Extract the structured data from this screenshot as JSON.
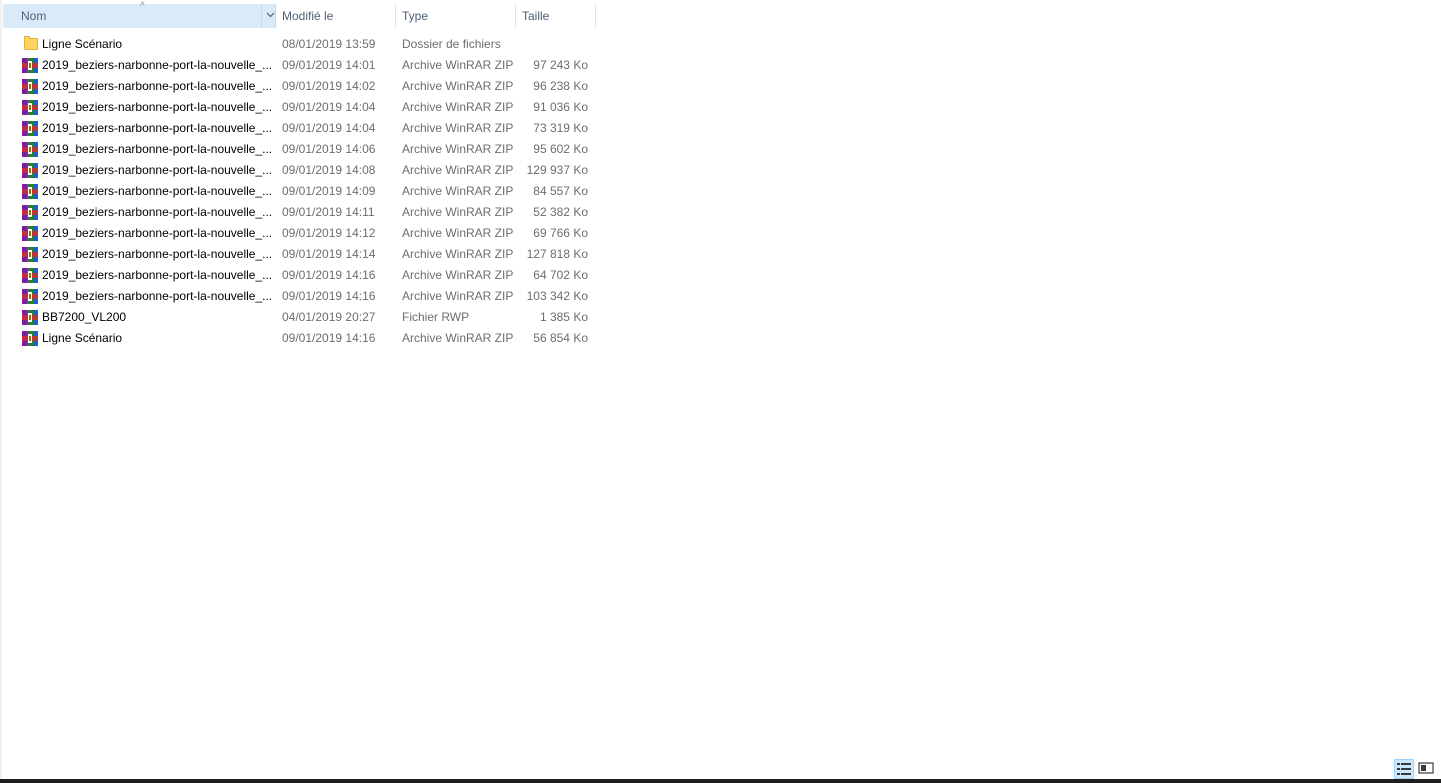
{
  "columns": {
    "name": "Nom",
    "modified": "Modifié le",
    "type": "Type",
    "size": "Taille"
  },
  "icons": {
    "sort": "sort-ascending-icon",
    "dropdown": "chevron-down-icon",
    "folder": "folder-icon",
    "archive": "winrar-archive-icon",
    "details_view": "details-view-icon",
    "tiles_view": "large-icons-view-icon"
  },
  "files": [
    {
      "name": "Ligne Scénario",
      "date": "08/01/2019 13:59",
      "type": "Dossier de fichiers",
      "size": "",
      "icon": "folder"
    },
    {
      "name": "2019_beziers-narbonne-port-la-nouvelle_...",
      "date": "09/01/2019 14:01",
      "type": "Archive WinRAR ZIP",
      "size": "97 243 Ko",
      "icon": "archive"
    },
    {
      "name": "2019_beziers-narbonne-port-la-nouvelle_...",
      "date": "09/01/2019 14:02",
      "type": "Archive WinRAR ZIP",
      "size": "96 238 Ko",
      "icon": "archive"
    },
    {
      "name": "2019_beziers-narbonne-port-la-nouvelle_...",
      "date": "09/01/2019 14:04",
      "type": "Archive WinRAR ZIP",
      "size": "91 036 Ko",
      "icon": "archive"
    },
    {
      "name": "2019_beziers-narbonne-port-la-nouvelle_...",
      "date": "09/01/2019 14:04",
      "type": "Archive WinRAR ZIP",
      "size": "73 319 Ko",
      "icon": "archive"
    },
    {
      "name": "2019_beziers-narbonne-port-la-nouvelle_...",
      "date": "09/01/2019 14:06",
      "type": "Archive WinRAR ZIP",
      "size": "95 602 Ko",
      "icon": "archive"
    },
    {
      "name": "2019_beziers-narbonne-port-la-nouvelle_...",
      "date": "09/01/2019 14:08",
      "type": "Archive WinRAR ZIP",
      "size": "129 937 Ko",
      "icon": "archive"
    },
    {
      "name": "2019_beziers-narbonne-port-la-nouvelle_...",
      "date": "09/01/2019 14:09",
      "type": "Archive WinRAR ZIP",
      "size": "84 557 Ko",
      "icon": "archive"
    },
    {
      "name": "2019_beziers-narbonne-port-la-nouvelle_...",
      "date": "09/01/2019 14:11",
      "type": "Archive WinRAR ZIP",
      "size": "52 382 Ko",
      "icon": "archive"
    },
    {
      "name": "2019_beziers-narbonne-port-la-nouvelle_...",
      "date": "09/01/2019 14:12",
      "type": "Archive WinRAR ZIP",
      "size": "69 766 Ko",
      "icon": "archive"
    },
    {
      "name": "2019_beziers-narbonne-port-la-nouvelle_...",
      "date": "09/01/2019 14:14",
      "type": "Archive WinRAR ZIP",
      "size": "127 818 Ko",
      "icon": "archive"
    },
    {
      "name": "2019_beziers-narbonne-port-la-nouvelle_...",
      "date": "09/01/2019 14:16",
      "type": "Archive WinRAR ZIP",
      "size": "64 702 Ko",
      "icon": "archive"
    },
    {
      "name": "2019_beziers-narbonne-port-la-nouvelle_...",
      "date": "09/01/2019 14:16",
      "type": "Archive WinRAR ZIP",
      "size": "103 342 Ko",
      "icon": "archive"
    },
    {
      "name": "BB7200_VL200",
      "date": "04/01/2019 20:27",
      "type": "Fichier RWP",
      "size": "1 385 Ko",
      "icon": "archive"
    },
    {
      "name": "Ligne Scénario",
      "date": "09/01/2019 14:16",
      "type": "Archive WinRAR ZIP",
      "size": "56 854 Ko",
      "icon": "archive"
    }
  ],
  "colors": {
    "header_text": "#4c607a",
    "selected_header_bg": "#d9ebf9",
    "secondary_text": "#6d6d6d"
  }
}
